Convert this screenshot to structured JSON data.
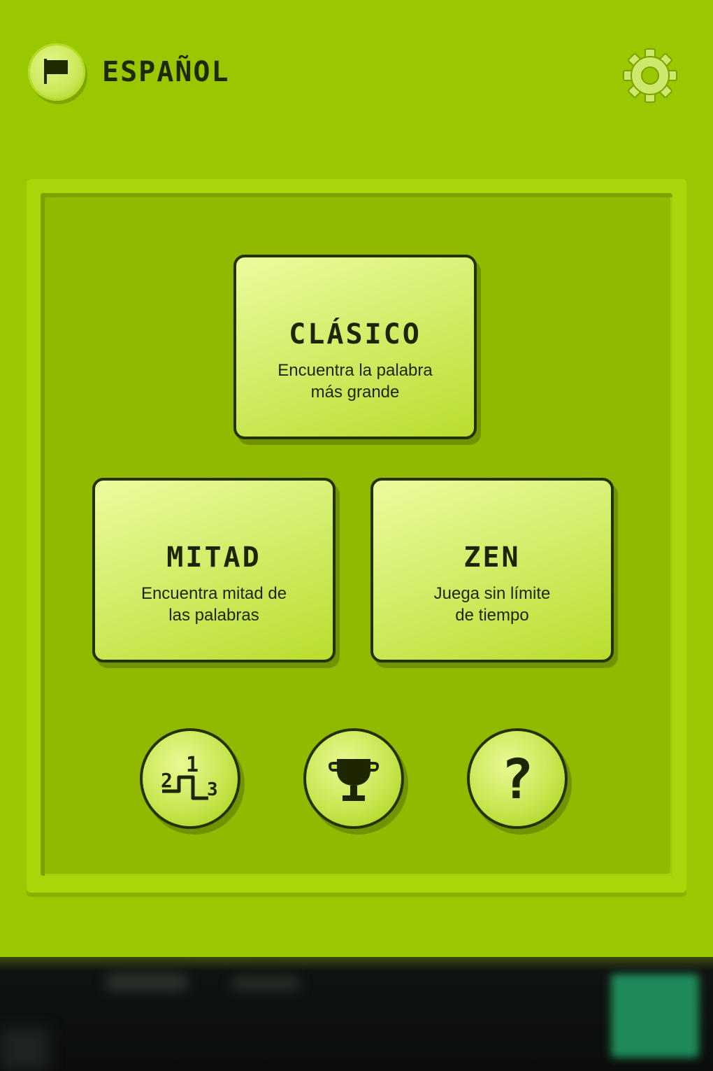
{
  "header": {
    "language_label": "ESPAÑOL",
    "language_icon": "flag-icon",
    "settings_icon": "gear-icon"
  },
  "modes": {
    "clasico": {
      "title": "CLÁSICO",
      "desc_line1": "Encuentra la palabra",
      "desc_line2": "más grande"
    },
    "mitad": {
      "title": "MITAD",
      "desc_line1": "Encuentra mitad de",
      "desc_line2": "las palabras"
    },
    "zen": {
      "title": "ZEN",
      "desc_line1": "Juega sin límite",
      "desc_line2": "de tiempo"
    }
  },
  "bottom_buttons": {
    "ranking_icon": "podium-icon",
    "trophy_icon": "trophy-icon",
    "help_icon": "question-icon",
    "podium_digits": [
      "1",
      "2",
      "3"
    ],
    "help_glyph": "?"
  },
  "colors": {
    "background": "#99c800",
    "card": "#d3ee6c",
    "outline": "#243100"
  }
}
